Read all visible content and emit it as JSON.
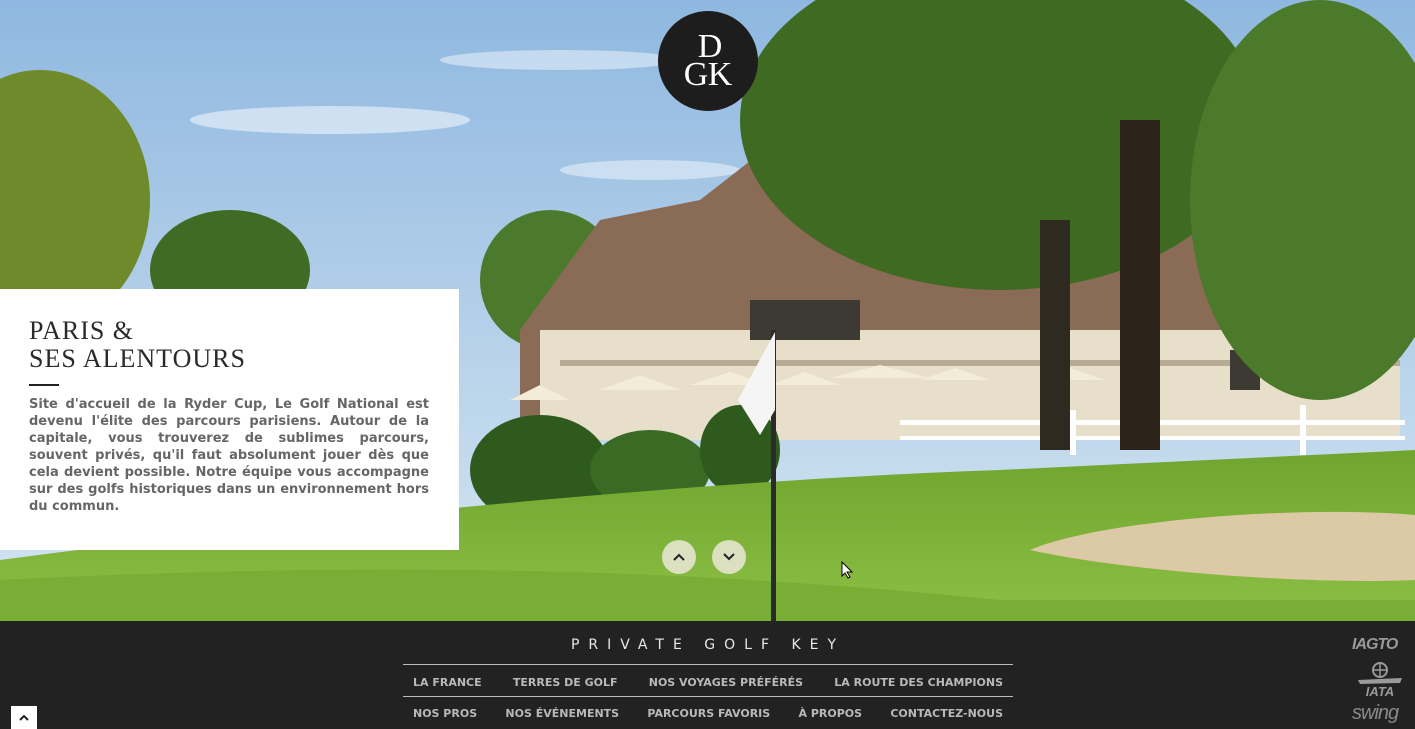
{
  "logo": {
    "name": "logo-monogram-icon",
    "letters": "DGK",
    "letter_top": "D",
    "letter_left": "G",
    "letter_right": "K"
  },
  "feature": {
    "title_line1": "PARIS &",
    "title_line2": "SES ALENTOURS",
    "description": "Site d'accueil de la Ryder Cup, Le Golf National est devenu l'élite des parcours parisiens. Autour de la capitale, vous trouverez de sublimes parcours, souvent privés, qu'il faut absolument jouer dès que cela devient possible. Notre équipe vous accompagne sur des golfs historiques dans un environnement hors du commun."
  },
  "slider": {
    "prev_icon": "chevron-up-icon",
    "next_icon": "chevron-down-icon"
  },
  "footer": {
    "brand": "PRIVATE GOLF KEY",
    "menu_row1": [
      "LA FRANCE",
      "TERRES DE GOLF",
      "NOS VOYAGES PRÉFÉRÉS",
      "LA ROUTE DES CHAMPIONS"
    ],
    "menu_row2": [
      "NOS PROS",
      "NOS ÉVÉNEMENTS",
      "PARCOURS FAVORIS",
      "À PROPOS",
      "CONTACTEZ-NOUS"
    ],
    "partners": {
      "iacto": "IAGTO",
      "iata": "IATA",
      "swing": "swing"
    }
  },
  "scroll_top": {
    "icon": "chevron-up-icon"
  },
  "colors": {
    "footer_bg": "#222222",
    "card_bg": "#ffffff",
    "text_gray": "#666666",
    "sky": "#9ec3e4",
    "grass": "#7fb33c"
  }
}
